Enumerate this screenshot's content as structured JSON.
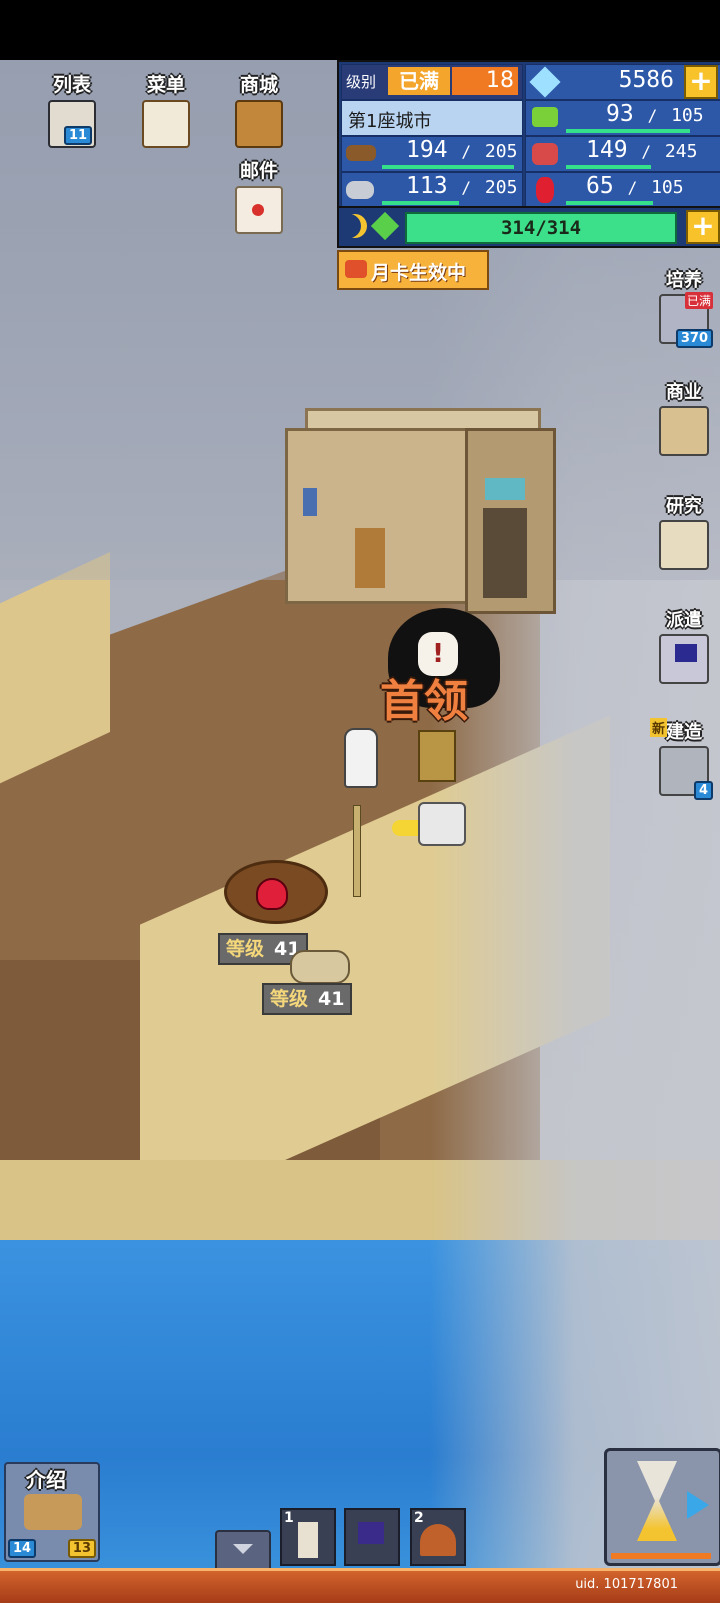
{
  "left_buttons": [
    {
      "label": "列表",
      "badge": "11",
      "icon": "scroll-list-icon"
    },
    {
      "label": "菜单",
      "icon": "signboard-icon"
    },
    {
      "label": "商城",
      "icon": "treasure-chest-icon"
    },
    {
      "label": "邮件",
      "icon": "envelope-icon"
    }
  ],
  "status": {
    "rank_label": "级别",
    "rank_status": "已满",
    "rank_value": "18",
    "city_name": "第1座城市",
    "diamonds": "5586",
    "moon_energy": "314/314",
    "month_card": "月卡生效中"
  },
  "resources": {
    "grass": {
      "value": "93",
      "max": "105",
      "fill": 0.886
    },
    "wood": {
      "value": "194",
      "max": "205",
      "fill": 0.946
    },
    "livestock": {
      "value": "149",
      "max": "245",
      "fill": 0.608
    },
    "ore": {
      "value": "113",
      "max": "205",
      "fill": 0.551
    },
    "gem": {
      "value": "65",
      "max": "105",
      "fill": 0.619
    }
  },
  "right_buttons": [
    {
      "label": "培养",
      "badge_top": "已满",
      "badge": "370",
      "icon": "training-icon"
    },
    {
      "label": "商业",
      "icon": "shop-house-icon"
    },
    {
      "label": "研究",
      "icon": "research-book-icon"
    },
    {
      "label": "派遣",
      "icon": "dispatch-flag-icon"
    },
    {
      "label": "建造",
      "new_tag": "新",
      "badge": "4",
      "icon": "hammer-icon"
    }
  ],
  "map": {
    "boss_label": "首领",
    "enemy_levels": [
      {
        "label": "等级",
        "value": "41"
      },
      {
        "label": "等级",
        "value": "41"
      }
    ]
  },
  "bottom": {
    "intro_label": "介绍",
    "intro_left_badge": "14",
    "intro_right_badge": "13",
    "slot1_number": "1",
    "slot2_number": "2",
    "uid": "uid. 101717801"
  },
  "colors": {
    "panel": "#1e3a75",
    "accent_gold": "#f7c22a",
    "bar_green": "#34e08a",
    "sea": "#2f86d8"
  }
}
